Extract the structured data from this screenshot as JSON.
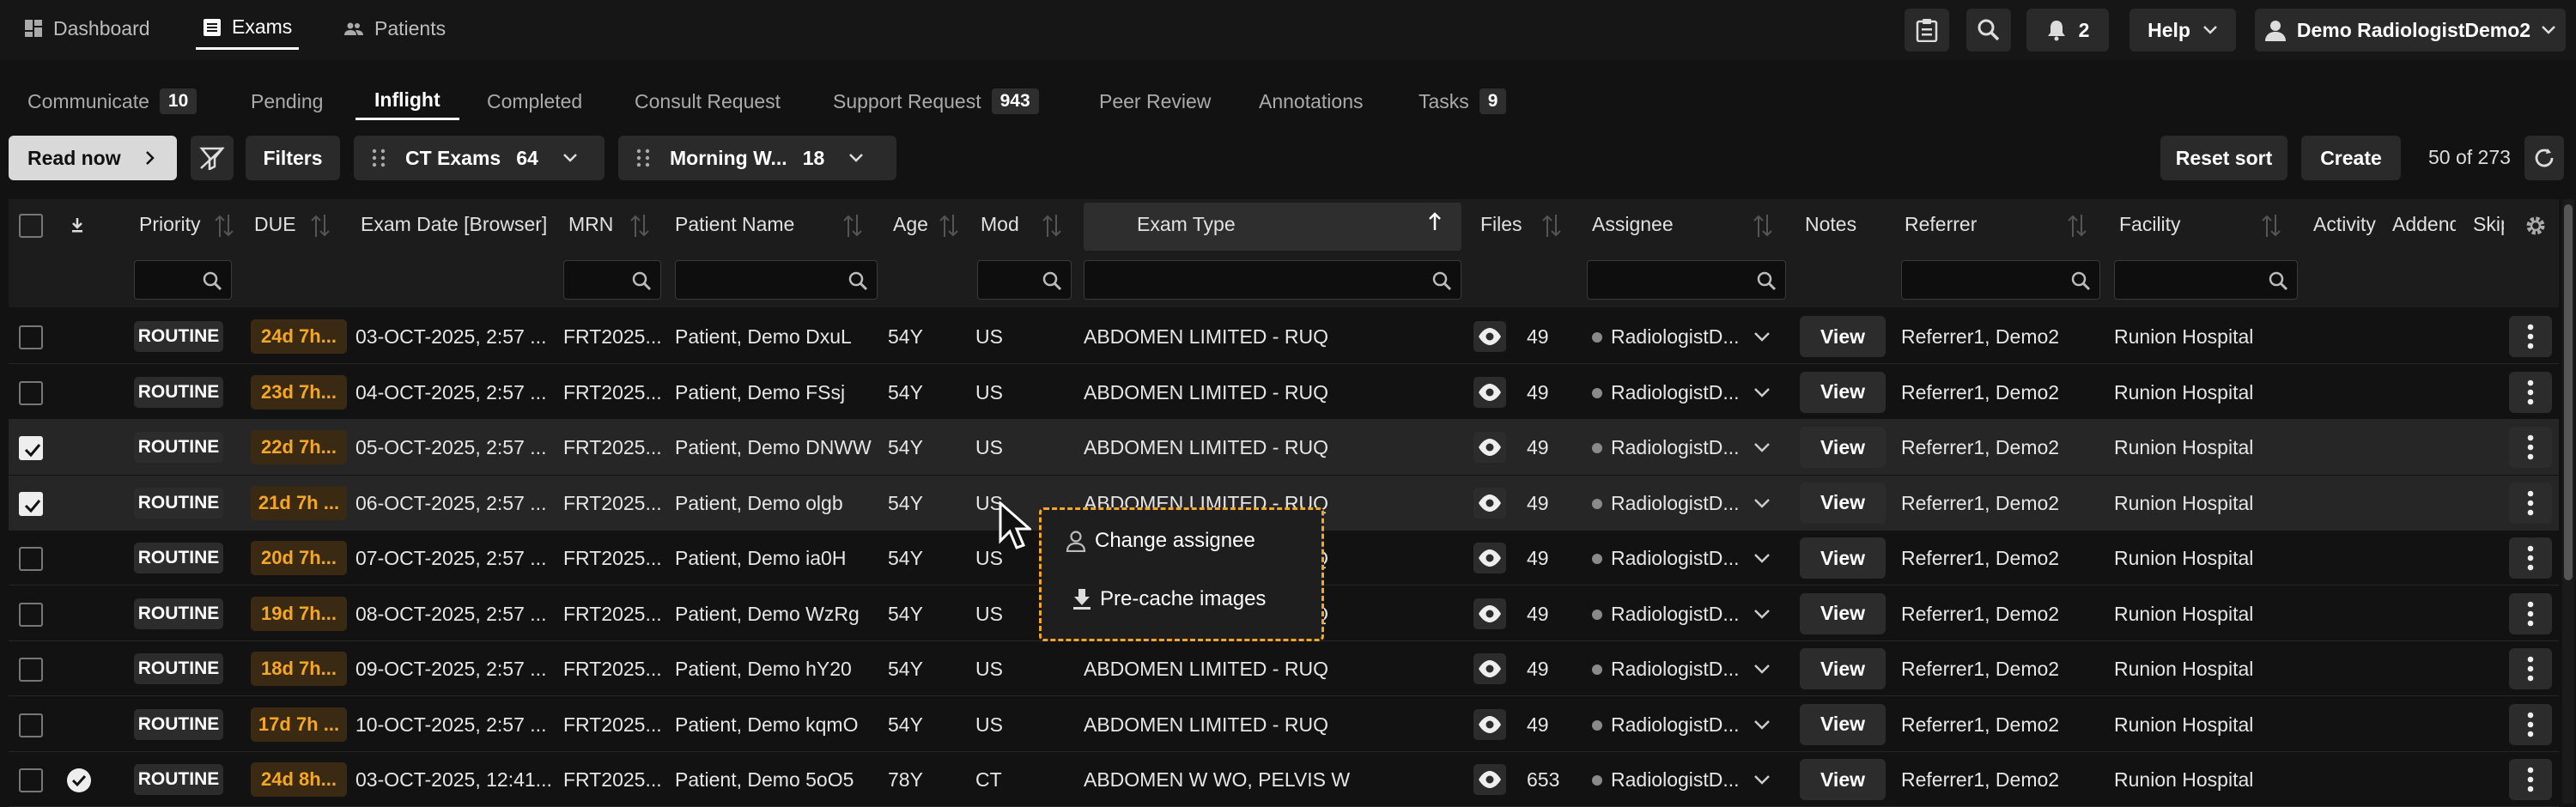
{
  "nav": {
    "tabs": [
      {
        "label": "Dashboard",
        "icon": "dashboard-icon"
      },
      {
        "label": "Exams",
        "icon": "list-icon",
        "active": true
      },
      {
        "label": "Patients",
        "icon": "people-icon"
      }
    ],
    "notifications_count": "2",
    "help_label": "Help",
    "user_label": "Demo RadiologistDemo2"
  },
  "subtabs": [
    {
      "label": "Communicate",
      "badge": "10"
    },
    {
      "label": "Pending",
      "badge": ""
    },
    {
      "label": "Inflight",
      "badge": "",
      "active": true
    },
    {
      "label": "Completed",
      "badge": ""
    },
    {
      "label": "Consult Request",
      "badge": ""
    },
    {
      "label": "Support Request",
      "badge": "943"
    },
    {
      "label": "Peer Review",
      "badge": ""
    },
    {
      "label": "Annotations",
      "badge": ""
    },
    {
      "label": "Tasks",
      "badge": "9"
    }
  ],
  "toolbar": {
    "read_now": "Read now",
    "filters": "Filters",
    "worklist1_label": "CT Exams",
    "worklist1_count": "64",
    "worklist2_label": "Morning W...",
    "worklist2_count": "18",
    "reset_sort": "Reset sort",
    "create": "Create",
    "pagination": "50 of 273"
  },
  "columns": {
    "priority": "Priority",
    "due": "DUE",
    "exam_date": "Exam Date [Browser]",
    "mrn": "MRN",
    "patient_name": "Patient Name",
    "age": "Age",
    "mod": "Mod",
    "exam_type": "Exam Type",
    "files": "Files",
    "assignee": "Assignee",
    "notes": "Notes",
    "referrer": "Referrer",
    "facility": "Facility",
    "activity": "Activity",
    "addendum": "Addend",
    "skip": "Skip"
  },
  "rows": [
    {
      "checked": false,
      "priority": "ROUTINE",
      "due": "24d 7h...",
      "exam_date": "03-OCT-2025, 2:57 ...",
      "mrn": "FRT2025...",
      "patient": "Patient, Demo DxuL",
      "age": "54Y",
      "mod": "US",
      "exam_type": "ABDOMEN LIMITED - RUQ",
      "files": "49",
      "assignee": "RadiologistD...",
      "notes": "View",
      "referrer": "Referrer1, Demo2",
      "facility": "Runion Hospital"
    },
    {
      "checked": false,
      "priority": "ROUTINE",
      "due": "23d 7h...",
      "exam_date": "04-OCT-2025, 2:57 ...",
      "mrn": "FRT2025...",
      "patient": "Patient, Demo FSsj",
      "age": "54Y",
      "mod": "US",
      "exam_type": "ABDOMEN LIMITED - RUQ",
      "files": "49",
      "assignee": "RadiologistD...",
      "notes": "View",
      "referrer": "Referrer1, Demo2",
      "facility": "Runion Hospital"
    },
    {
      "checked": true,
      "priority": "ROUTINE",
      "due": "22d 7h...",
      "exam_date": "05-OCT-2025, 2:57 ...",
      "mrn": "FRT2025...",
      "patient": "Patient, Demo DNWW",
      "age": "54Y",
      "mod": "US",
      "exam_type": "ABDOMEN LIMITED - RUQ",
      "files": "49",
      "assignee": "RadiologistD...",
      "notes": "View",
      "referrer": "Referrer1, Demo2",
      "facility": "Runion Hospital"
    },
    {
      "checked": true,
      "priority": "ROUTINE",
      "due": "21d 7h ...",
      "exam_date": "06-OCT-2025, 2:57 ...",
      "mrn": "FRT2025...",
      "patient": "Patient, Demo olgb",
      "age": "54Y",
      "mod": "US",
      "exam_type": "ABDOMEN LIMITED - RUQ",
      "files": "49",
      "assignee": "RadiologistD...",
      "notes": "View",
      "referrer": "Referrer1, Demo2",
      "facility": "Runion Hospital"
    },
    {
      "checked": false,
      "priority": "ROUTINE",
      "due": "20d 7h...",
      "exam_date": "07-OCT-2025, 2:57 ...",
      "mrn": "FRT2025...",
      "patient": "Patient, Demo ia0H",
      "age": "54Y",
      "mod": "US",
      "exam_type": "ABDOMEN LIMITED - RUQ",
      "files": "49",
      "assignee": "RadiologistD...",
      "notes": "View",
      "referrer": "Referrer1, Demo2",
      "facility": "Runion Hospital"
    },
    {
      "checked": false,
      "priority": "ROUTINE",
      "due": "19d 7h...",
      "exam_date": "08-OCT-2025, 2:57 ...",
      "mrn": "FRT2025...",
      "patient": "Patient, Demo WzRg",
      "age": "54Y",
      "mod": "US",
      "exam_type": "ABDOMEN LIMITED - RUQ",
      "files": "49",
      "assignee": "RadiologistD...",
      "notes": "View",
      "referrer": "Referrer1, Demo2",
      "facility": "Runion Hospital"
    },
    {
      "checked": false,
      "priority": "ROUTINE",
      "due": "18d 7h...",
      "exam_date": "09-OCT-2025, 2:57 ...",
      "mrn": "FRT2025...",
      "patient": "Patient, Demo hY20",
      "age": "54Y",
      "mod": "US",
      "exam_type": "ABDOMEN LIMITED - RUQ",
      "files": "49",
      "assignee": "RadiologistD...",
      "notes": "View",
      "referrer": "Referrer1, Demo2",
      "facility": "Runion Hospital"
    },
    {
      "checked": false,
      "priority": "ROUTINE",
      "due": "17d 7h ...",
      "exam_date": "10-OCT-2025, 2:57 ...",
      "mrn": "FRT2025...",
      "patient": "Patient, Demo kqmO",
      "age": "54Y",
      "mod": "US",
      "exam_type": "ABDOMEN LIMITED - RUQ",
      "files": "49",
      "assignee": "RadiologistD...",
      "notes": "View",
      "referrer": "Referrer1, Demo2",
      "facility": "Runion Hospital"
    },
    {
      "checked": false,
      "priority": "ROUTINE",
      "due": "24d 8h...",
      "exam_date": "03-OCT-2025, 12:41...",
      "mrn": "FRT2025...",
      "patient": "Patient, Demo 5oO5",
      "age": "78Y",
      "mod": "CT",
      "exam_type": "ABDOMEN W WO, PELVIS W",
      "files": "653",
      "assignee": "RadiologistD...",
      "notes": "View",
      "referrer": "Referrer1, Demo2",
      "facility": "Runion Hospital",
      "completed": true
    }
  ],
  "context_menu": {
    "change_assignee": "Change assignee",
    "pre_cache": "Pre-cache images"
  },
  "colors": {
    "accent": "#f5a623",
    "background": "#121212"
  }
}
